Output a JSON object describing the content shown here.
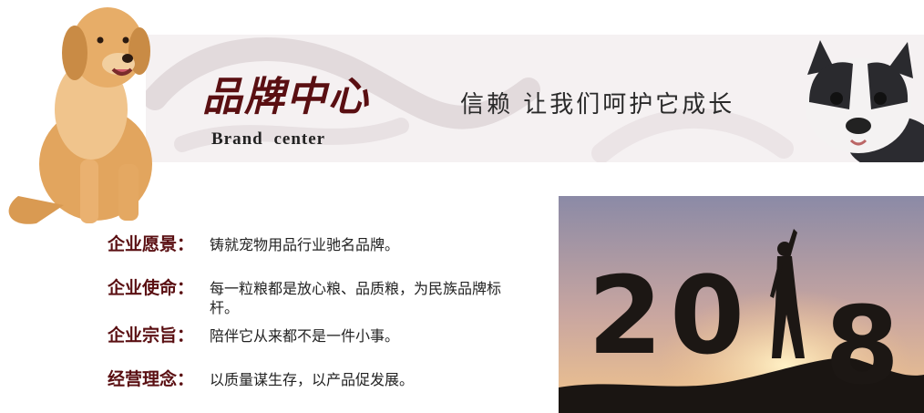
{
  "banner": {
    "title": "品牌中心",
    "subtitle": "Brand center",
    "slogan": "信赖  让我们呵护它成长"
  },
  "info": [
    {
      "label": "企业愿景：",
      "text": "铸就宠物用品行业驰名品牌。"
    },
    {
      "label": "企业使命：",
      "text": "每一粒粮都是放心粮、品质粮，为民族品牌标杆。"
    },
    {
      "label": "企业宗旨：",
      "text": "陪伴它从来都不是一件小事。"
    },
    {
      "label": "经营理念：",
      "text": "以质量谋生存，以产品促发展。"
    }
  ],
  "poster": {
    "year_digits": [
      "2",
      "0",
      "8"
    ]
  },
  "colors": {
    "brand_red": "#5a0f12",
    "banner_bg": "#f5f1f2",
    "sky_top": "#8e8ea8",
    "sky_glow": "#f4c48a"
  }
}
